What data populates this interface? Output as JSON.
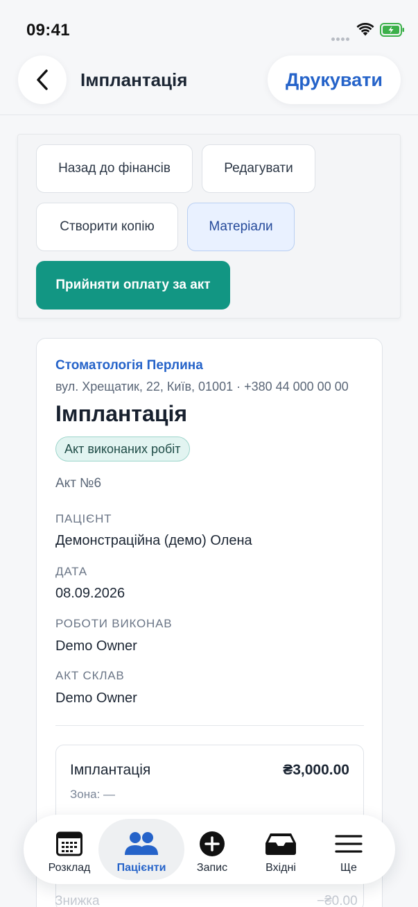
{
  "status_bar": {
    "time": "09:41"
  },
  "header": {
    "title": "Імплантація",
    "print_label": "Друкувати"
  },
  "actions": {
    "back_to_finance": "Назад до фінансів",
    "edit": "Редагувати",
    "copy": "Створити копію",
    "materials": "Матеріали",
    "accept_payment": "Прийняти оплату за акт"
  },
  "document": {
    "clinic_name": "Стоматологія Перлина",
    "clinic_address": "вул. Хрещатик, 22, Київ, 01001 · +380 44 000 00 00",
    "title": "Імплантація",
    "type_badge": "Акт виконаних робіт",
    "act_number": "Акт №6",
    "fields": [
      {
        "label": "ПАЦІЄНТ",
        "value": "Демонстраційна (демо) Олена"
      },
      {
        "label": "ДАТА",
        "value": "08.09.2026"
      },
      {
        "label": "РОБОТИ ВИКОНАВ",
        "value": "Demo Owner"
      },
      {
        "label": "АКТ СКЛАВ",
        "value": "Demo Owner"
      }
    ],
    "services": [
      {
        "name": "Імплантація",
        "price": "₴3,000.00",
        "zone": "Зона: —"
      }
    ],
    "discount_label": "Знижка",
    "discount_value": "−₴0.00"
  },
  "tabbar": {
    "items": [
      {
        "label": "Розклад",
        "icon": "calendar-icon"
      },
      {
        "label": "Пацієнти",
        "icon": "users-icon",
        "active": true
      },
      {
        "label": "Запис",
        "icon": "plus-circle-icon"
      },
      {
        "label": "Вхідні",
        "icon": "inbox-icon"
      },
      {
        "label": "Ще",
        "icon": "menu-icon"
      }
    ]
  },
  "colors": {
    "accent": "#2563c9",
    "primary_button": "#129683",
    "badge_bg": "#e2f4f1"
  }
}
